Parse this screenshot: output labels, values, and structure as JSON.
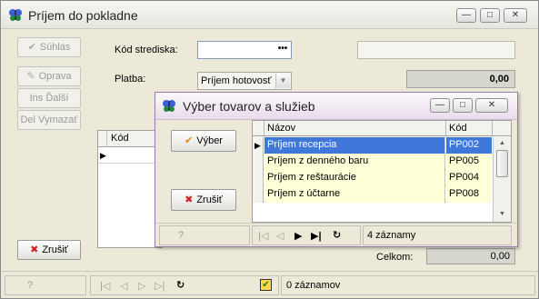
{
  "window": {
    "title": "Príjem do pokladne",
    "controls": {
      "minimize": "—",
      "maximize": "□",
      "close": "✕"
    }
  },
  "left_buttons": {
    "suhlas": "Súhlas",
    "oprava": "Oprava",
    "ins_dalsi": "Ins Ďalší",
    "del_vymazat": "Del Vymazať",
    "zrusit": "Zrušiť"
  },
  "form": {
    "kod_strediska_label": "Kód strediska:",
    "kod_strediska_value": "",
    "ellipsis": "•••",
    "platba_label": "Platba:",
    "platba_value": "Príjem hotovosť",
    "amount": "0,00"
  },
  "grid": {
    "col_kod": "Kód"
  },
  "totals": {
    "label": "Celkom:",
    "value": "0,00"
  },
  "status": {
    "help": "?",
    "nav_first": "|◁",
    "nav_prev": "◁",
    "nav_next": "▷",
    "nav_last": "▷|",
    "refresh": "↻",
    "count": "0 záznamov"
  },
  "dialog": {
    "title": "Výber tovarov a služieb",
    "controls": {
      "minimize": "—",
      "maximize": "□",
      "close": "✕"
    },
    "vyber": "Výber",
    "zrusit": "Zrušiť",
    "columns": {
      "name": "Názov",
      "code": "Kód"
    },
    "rows": [
      {
        "name": "Príjem recepcia",
        "code": "PP002"
      },
      {
        "name": "Príjem z denného baru",
        "code": "PP005"
      },
      {
        "name": "Príjem z reštaurácie",
        "code": "PP004"
      },
      {
        "name": "Príjem z účtarne",
        "code": "PP008"
      }
    ],
    "status": {
      "help": "?",
      "nav_first": "|◁",
      "nav_prev": "◁",
      "nav_next": "▶",
      "nav_last": "▶|",
      "refresh": "↻",
      "count": "4 záznamy"
    }
  },
  "colors": {
    "selected_row": "#3f78d8",
    "row_bg": "#ffffd8",
    "icon_check": "#e0861a",
    "icon_x": "#d42020"
  }
}
